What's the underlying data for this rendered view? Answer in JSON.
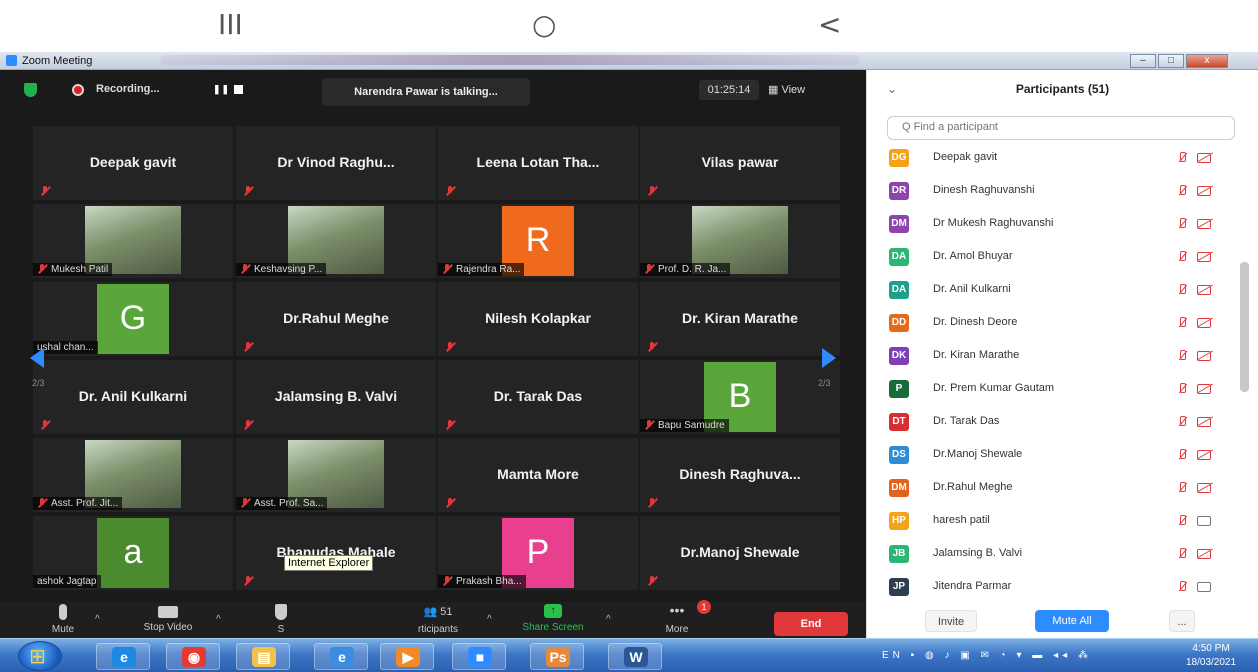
{
  "phone_nav": {
    "recents": "III",
    "home": "○",
    "back": "<"
  },
  "window": {
    "title": "Zoom Meeting",
    "min": "–",
    "max": "□",
    "close": "x"
  },
  "meeting": {
    "recording_label": "Recording...",
    "talking": "Narendra Pawar is talking...",
    "timer": "01:25:14",
    "view_label": "View",
    "page_left": "2/3",
    "page_right": "2/3"
  },
  "tiles": [
    {
      "name": "Deepak gavit"
    },
    {
      "name": "Dr Vinod Raghu..."
    },
    {
      "name": "Leena Lotan Tha..."
    },
    {
      "name": "Vilas pawar"
    },
    {
      "tag": "Mukesh Patil",
      "photo": true
    },
    {
      "tag": "Keshavsing P...",
      "photo": true
    },
    {
      "tag": "Rajendra Ra...",
      "letter": "R",
      "color": "#ef6a1c"
    },
    {
      "tag": "Prof. D. R. Ja...",
      "photo": true
    },
    {
      "tag": "ushal chan...",
      "letter": "G",
      "color": "#5aa63a",
      "nomic": true
    },
    {
      "name": "Dr.Rahul Meghe"
    },
    {
      "name": "Nilesh Kolapkar"
    },
    {
      "name": "Dr. Kiran Marathe"
    },
    {
      "name": "Dr. Anil Kulkarni"
    },
    {
      "name": "Jalamsing B. Valvi"
    },
    {
      "name": "Dr. Tarak Das"
    },
    {
      "tag": "Bapu Samudre",
      "letter": "B",
      "color": "#5aa63a"
    },
    {
      "tag": "Asst. Prof. Jit...",
      "photo": true
    },
    {
      "tag": "Asst. Prof. Sa...",
      "photo": true
    },
    {
      "name": "Mamta More"
    },
    {
      "name": "Dinesh Raghuva..."
    },
    {
      "tag": "ashok Jagtap",
      "letter": "a",
      "color": "#4c8a30",
      "nomic": true
    },
    {
      "name": "Bhanudas Mahale"
    },
    {
      "tag": "Prakash Bha...",
      "letter": "P",
      "color": "#e8408f"
    },
    {
      "name": "Dr.Manoj Shewale"
    }
  ],
  "toolbar": {
    "mute": "Mute",
    "stop_video": "Stop Video",
    "security_partial": "S",
    "participants_count": "51",
    "participants_partial": "rticipants",
    "share": "Share Screen",
    "more": "More",
    "more_badge": "1",
    "end": "End",
    "tooltip": "Internet Explorer"
  },
  "panel": {
    "title": "Participants (51)",
    "search_placeholder": "Q Find a participant",
    "invite": "Invite",
    "mute_all": "Mute All",
    "more": "..."
  },
  "participants": [
    {
      "initials": "DG",
      "name": "Deepak gavit",
      "color": "#f5a21b",
      "cam_off": false
    },
    {
      "initials": "DR",
      "name": "Dinesh Raghuvanshi",
      "color": "#8e44ad",
      "cam_off": false
    },
    {
      "initials": "DM",
      "name": "Dr Mukesh Raghuvanshi",
      "color": "#8e44ad",
      "cam_off": false
    },
    {
      "initials": "DA",
      "name": "Dr. Amol Bhuyar",
      "color": "#2bb673",
      "cam_off": false
    },
    {
      "initials": "DA",
      "name": "Dr. Anil Kulkarni",
      "color": "#1f9e8b",
      "cam_off": false
    },
    {
      "initials": "DD",
      "name": "Dr. Dinesh Deore",
      "color": "#e8681c",
      "cam_off": false
    },
    {
      "initials": "DK",
      "name": "Dr. Kiran Marathe",
      "color": "#7d3fb5",
      "cam_off": false
    },
    {
      "initials": "P",
      "name": "Dr. Prem Kumar Gautam",
      "color": "#1b6b3a",
      "cam_off": false
    },
    {
      "initials": "DT",
      "name": "Dr. Tarak Das",
      "color": "#d62f2f",
      "cam_off": false
    },
    {
      "initials": "DS",
      "name": "Dr.Manoj Shewale",
      "color": "#2d8cd6",
      "cam_off": false
    },
    {
      "initials": "DM",
      "name": "Dr.Rahul Meghe",
      "color": "#e2621b",
      "cam_off": false
    },
    {
      "initials": "HP",
      "name": "haresh patil",
      "color": "#f5a21b",
      "cam_off": true
    },
    {
      "initials": "JB",
      "name": "Jalamsing B. Valvi",
      "color": "#2bb673",
      "cam_off": false
    },
    {
      "initials": "JP",
      "name": "Jitendra Parmar",
      "color": "#2c3e50",
      "cam_off": true
    }
  ],
  "taskbar": {
    "apps": [
      {
        "name": "edge",
        "glyph": "e",
        "color": "#1e88e5"
      },
      {
        "name": "chrome",
        "glyph": "◉",
        "color": "#e53935"
      },
      {
        "name": "explorer",
        "glyph": "▤",
        "color": "#f2c14e"
      },
      {
        "name": "ie",
        "glyph": "e",
        "color": "#3a8de0"
      },
      {
        "name": "media",
        "glyph": "▶",
        "color": "#f18b2a"
      },
      {
        "name": "zoom",
        "glyph": "■",
        "color": "#2d8cff"
      },
      {
        "name": "photoshop",
        "glyph": "Ps",
        "color": "#e6893a"
      },
      {
        "name": "word",
        "glyph": "W",
        "color": "#2b5797"
      }
    ],
    "lang": "EN",
    "time": "4:50 PM",
    "date": "18/03/2021"
  }
}
